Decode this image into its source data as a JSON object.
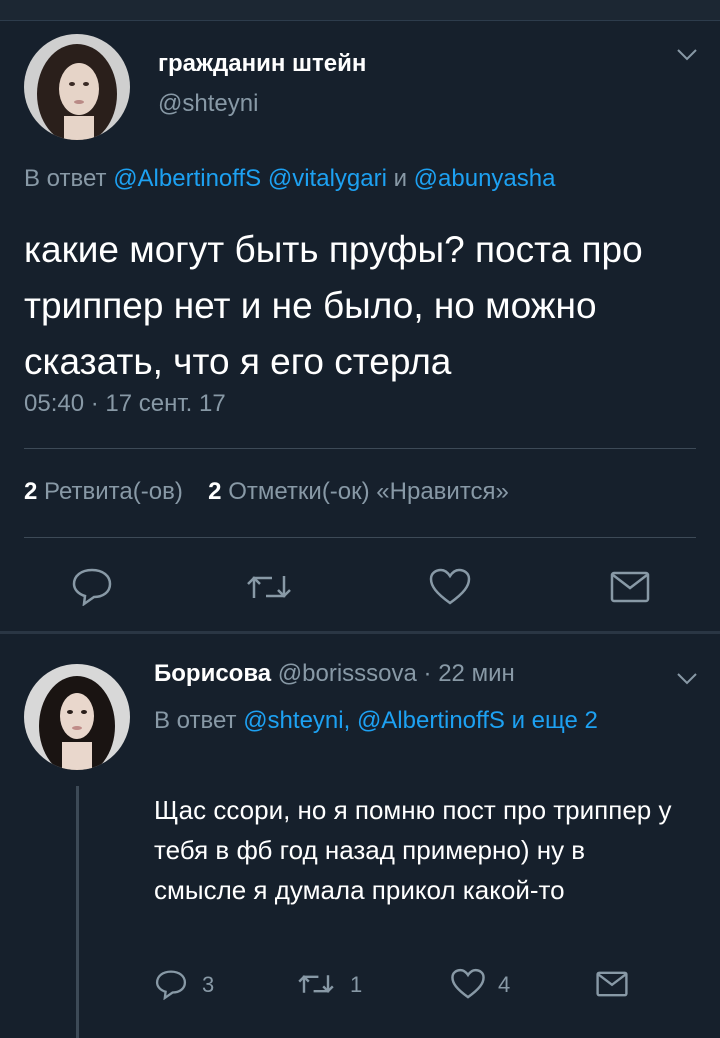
{
  "main_tweet": {
    "author_name": "гражданин штейн",
    "author_handle": "@shteyni",
    "reply_prefix": "В ответ",
    "reply_mention_1": "@AlbertinoffS",
    "reply_mention_2": "@vitalygari",
    "reply_and": "и",
    "reply_mention_3": "@abunyasha",
    "text": "какие могут быть пруфы? поста про триппер нет и не было, но можно сказать, что я его стерла",
    "timestamp": "05:40 · 17 сент. 17",
    "retweets_count": "2",
    "retweets_label": "Ретвита(-ов)",
    "likes_count": "2",
    "likes_label": "Отметки(-ок) «Нравится»",
    "icons": [
      "reply-icon",
      "retweet-icon",
      "like-icon",
      "direct-message-icon"
    ]
  },
  "reply_tweet": {
    "author_name": "Борисова",
    "author_handle": "@borisssova",
    "time_ago": "· 22 мин",
    "reply_prefix": "В ответ",
    "reply_mention_1": "@shteyni,",
    "reply_mention_2": "@AlbertinoffS",
    "reply_more": "и еще 2",
    "text": "Щас ссори, но я помню пост про триппер у тебя в фб год назад примерно) ну в смысле я думала прикол какой-то",
    "reply_count": "3",
    "retweet_count": "1",
    "like_count": "4"
  },
  "colors": {
    "background": "#16202c",
    "link": "#1da1f2",
    "secondary_text": "#8899a6",
    "divider": "#3d4a57"
  }
}
